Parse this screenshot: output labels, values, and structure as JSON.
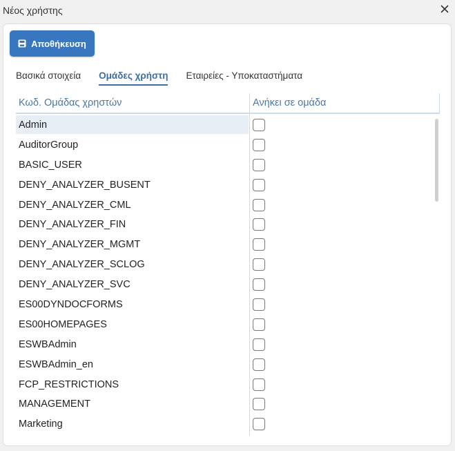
{
  "window": {
    "title": "Νέος χρήστης"
  },
  "toolbar": {
    "save_label": "Αποθήκευση",
    "save_icon": "floppy-disk-icon"
  },
  "tabs": [
    {
      "label": "Βασικά στοιχεία",
      "active": false
    },
    {
      "label": "Ομάδες χρήστη",
      "active": true
    },
    {
      "label": "Εταιρείες - Υποκαταστήματα",
      "active": false
    }
  ],
  "grid": {
    "columns": [
      "Κωδ. Ομάδας χρηστών",
      "Ανήκει σε ομάδα"
    ],
    "rows": [
      {
        "name": "Admin",
        "member": false,
        "selected": true
      },
      {
        "name": "AuditorGroup",
        "member": false
      },
      {
        "name": "BASIC_USER",
        "member": false
      },
      {
        "name": "DENY_ANALYZER_BUSENT",
        "member": false
      },
      {
        "name": "DENY_ANALYZER_CML",
        "member": false
      },
      {
        "name": "DENY_ANALYZER_FIN",
        "member": false
      },
      {
        "name": "DENY_ANALYZER_MGMT",
        "member": false
      },
      {
        "name": "DENY_ANALYZER_SCLOG",
        "member": false
      },
      {
        "name": "DENY_ANALYZER_SVC",
        "member": false
      },
      {
        "name": "ES00DYNDOCFORMS",
        "member": false
      },
      {
        "name": "ES00HOMEPAGES",
        "member": false
      },
      {
        "name": "ESWBAdmin",
        "member": false
      },
      {
        "name": "ESWBAdmin_en",
        "member": false
      },
      {
        "name": "FCP_RESTRICTIONS",
        "member": false
      },
      {
        "name": "MANAGEMENT",
        "member": false
      },
      {
        "name": "Marketing",
        "member": false
      }
    ]
  },
  "colors": {
    "accent": "#3876bf",
    "tab_active": "#3b6ea5",
    "header_text": "#4a77a6",
    "selected_row": "#e8eef6"
  }
}
